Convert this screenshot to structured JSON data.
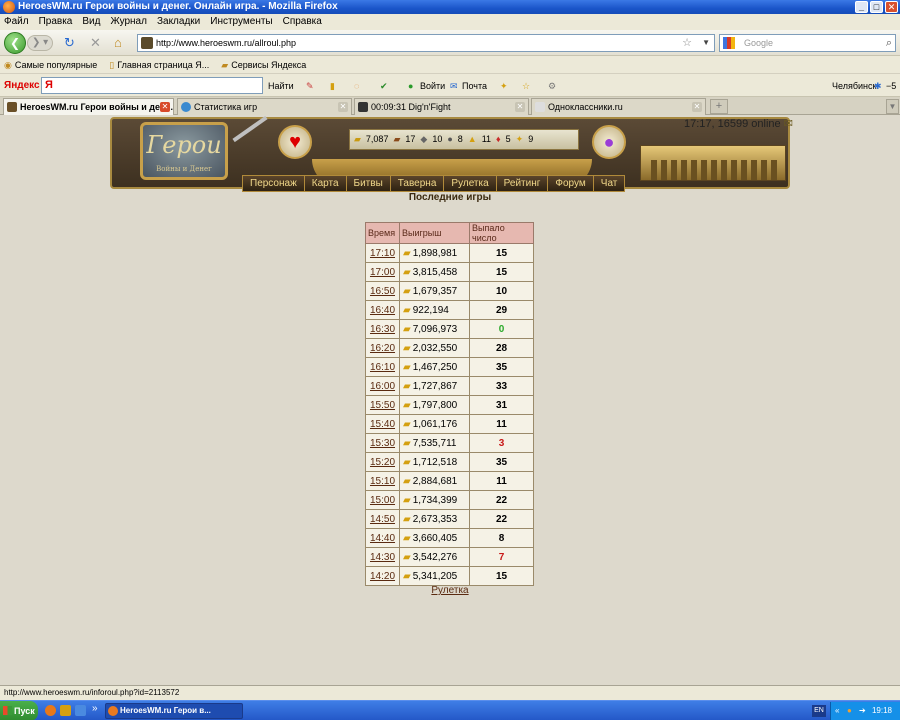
{
  "window": {
    "title": "HeroesWM.ru Герои войны и денег. Онлайн игра. - Mozilla Firefox"
  },
  "menu": [
    "Файл",
    "Правка",
    "Вид",
    "Журнал",
    "Закладки",
    "Инструменты",
    "Справка"
  ],
  "navbar": {
    "url": "http://www.heroeswm.ru/allroul.php",
    "search_placeholder": "Google"
  },
  "bookmarks": [
    "Самые популярные",
    "Главная страница Я...",
    "Сервисы Яндекса"
  ],
  "yandex_bar": {
    "logo": "Яндекс",
    "input": "Я",
    "find": "Найти",
    "login": "Войти",
    "mail": "Почта",
    "city": "Челябинск",
    "temp": "−5"
  },
  "tabs": [
    {
      "label": "HeroesWM.ru Герои войны и ден..."
    },
    {
      "label": "Статистика игр"
    },
    {
      "label": "00:09:31 Dig'n'Fight"
    },
    {
      "label": "Одноклассники.ru"
    }
  ],
  "game": {
    "logo_title": "Герои",
    "logo_sub": "Войны и Денег",
    "online_info": "17:17, 16599 online",
    "resources": {
      "gold": "7,087",
      "wood": "17",
      "ore": "10",
      "mercury": "8",
      "sulfur": "11",
      "crystals": "5",
      "gems": "9"
    },
    "nav": [
      "Персонаж",
      "Карта",
      "Битвы",
      "Таверна",
      "Рулетка",
      "Рейтинг",
      "Форум",
      "Чат"
    ],
    "page_title": "Последние игры",
    "table": {
      "headers": [
        "Время",
        "Выигрыш",
        "Выпало число"
      ],
      "rows": [
        {
          "time": "17:10",
          "win": "1,898,981",
          "num": "15",
          "color": "black"
        },
        {
          "time": "17:00",
          "win": "3,815,458",
          "num": "15",
          "color": "black"
        },
        {
          "time": "16:50",
          "win": "1,679,357",
          "num": "10",
          "color": "black"
        },
        {
          "time": "16:40",
          "win": "922,194",
          "num": "29",
          "color": "black"
        },
        {
          "time": "16:30",
          "win": "7,096,973",
          "num": "0",
          "color": "green"
        },
        {
          "time": "16:20",
          "win": "2,032,550",
          "num": "28",
          "color": "black"
        },
        {
          "time": "16:10",
          "win": "1,467,250",
          "num": "35",
          "color": "black"
        },
        {
          "time": "16:00",
          "win": "1,727,867",
          "num": "33",
          "color": "black"
        },
        {
          "time": "15:50",
          "win": "1,797,800",
          "num": "31",
          "color": "black"
        },
        {
          "time": "15:40",
          "win": "1,061,176",
          "num": "11",
          "color": "black"
        },
        {
          "time": "15:30",
          "win": "7,535,711",
          "num": "3",
          "color": "red"
        },
        {
          "time": "15:20",
          "win": "1,712,518",
          "num": "35",
          "color": "black"
        },
        {
          "time": "15:10",
          "win": "2,884,681",
          "num": "11",
          "color": "black"
        },
        {
          "time": "15:00",
          "win": "1,734,399",
          "num": "22",
          "color": "black"
        },
        {
          "time": "14:50",
          "win": "2,673,353",
          "num": "22",
          "color": "black"
        },
        {
          "time": "14:40",
          "win": "3,660,405",
          "num": "8",
          "color": "black"
        },
        {
          "time": "14:30",
          "win": "3,542,276",
          "num": "7",
          "color": "red"
        },
        {
          "time": "14:20",
          "win": "5,341,205",
          "num": "15",
          "color": "black"
        }
      ]
    },
    "bottom_link": "Рулетка"
  },
  "statusbar": {
    "text": "http://www.heroeswm.ru/inforoul.php?id=2113572"
  },
  "taskbar": {
    "start": "Пуск",
    "task": "HeroesWM.ru Герои в...",
    "lang": "EN",
    "time": "19:18"
  }
}
